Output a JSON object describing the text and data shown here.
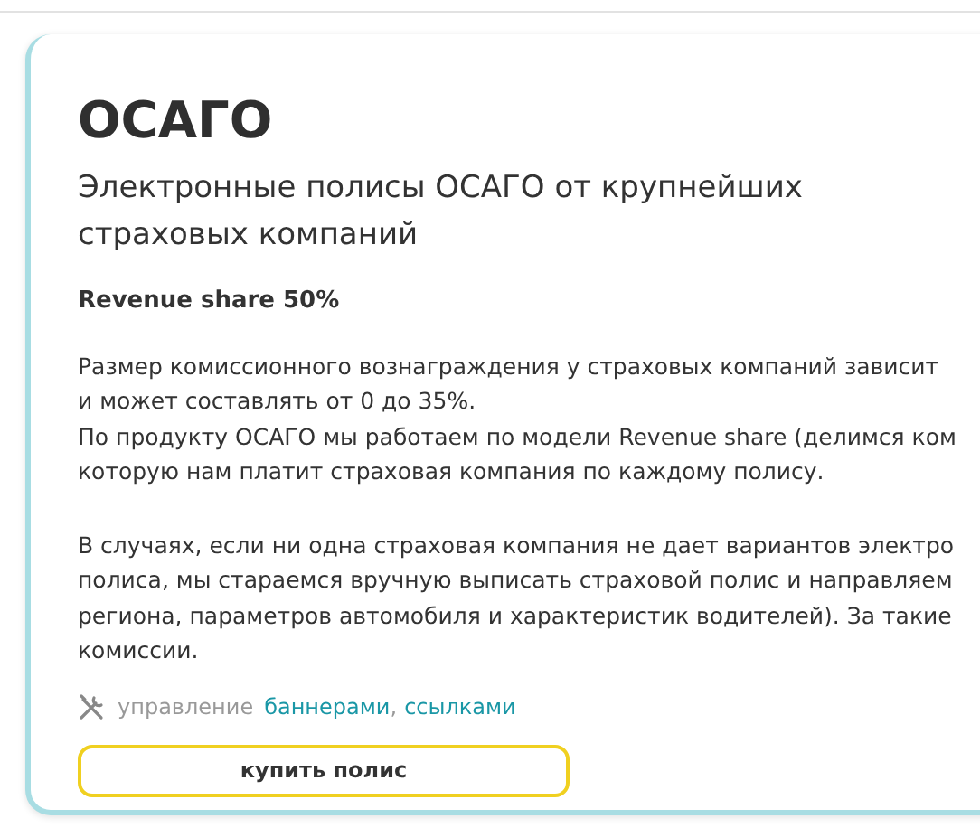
{
  "card": {
    "title": "ОСАГО",
    "subtitle": "Электронные полисы ОСАГО от крупнейших страховых компаний",
    "revenue": "Revenue share 50%",
    "paragraphs": [
      [
        "Размер комиссионного вознаграждения у страховых компаний зависит",
        "и может составлять от 0 до 35%.",
        "По продукту ОСАГО мы работаем по модели Revenue share (делимся ком",
        "которую нам платит страховая компания по каждому полису."
      ],
      [
        "В случаях, если ни одна страховая компания не дает вариантов электро",
        "полиса, мы стараемся вручную выписать страховой полис и направляем",
        "региона, параметров автомобиля и характеристик водителей). За такие",
        "комиссии."
      ]
    ],
    "manage": {
      "label": "управление",
      "links": [
        "баннерами",
        "ссылками"
      ],
      "separator": ","
    },
    "button": "купить полис"
  }
}
